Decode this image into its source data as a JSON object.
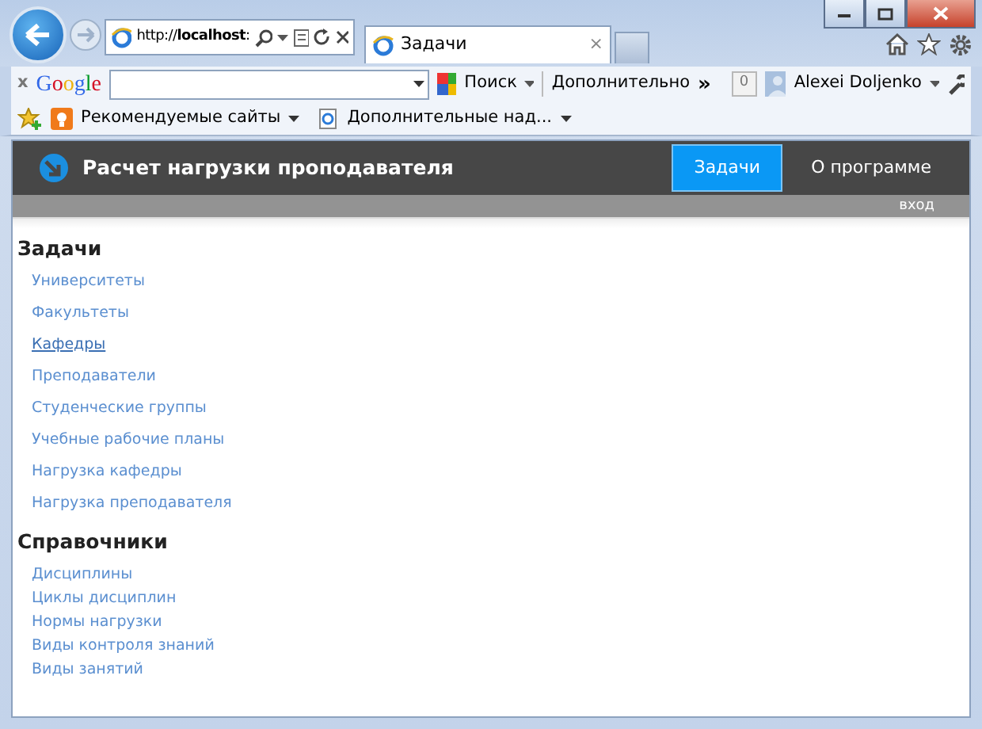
{
  "browser": {
    "address": "http://**localhost**:",
    "tab": {
      "title": "Задачи",
      "close": "×"
    },
    "toolbar": {
      "close": "x",
      "logo": "Google",
      "search_label": "Поиск",
      "more": "Дополнительно",
      "more_glyph": "»",
      "counter": "0",
      "user": "Alexei Doljenko"
    },
    "favorites": [
      {
        "label": "Рекомендуемые сайты",
        "kind": "suggested"
      },
      {
        "label": "Дополнительные над...",
        "kind": "addons"
      }
    ]
  },
  "app": {
    "title": "Расчет нагрузки проподавателя",
    "nav": [
      {
        "label": "Задачи",
        "selected": true
      },
      {
        "label": "О программе",
        "selected": false
      }
    ],
    "login": "вход"
  },
  "sections": [
    {
      "heading": "Задачи",
      "items": [
        {
          "label": "Университеты",
          "hovered": false
        },
        {
          "label": "Факультеты",
          "hovered": false
        },
        {
          "label": "Кафедры",
          "hovered": true
        },
        {
          "label": "Преподаватели",
          "hovered": false
        },
        {
          "label": "Студенческие группы",
          "hovered": false
        },
        {
          "label": "Учебные рабочие планы",
          "hovered": false
        },
        {
          "label": "Нагрузка кафедры",
          "hovered": false
        },
        {
          "label": "Нагрузка преподавателя",
          "hovered": false
        }
      ]
    },
    {
      "heading": "Справочники",
      "items": [
        {
          "label": "Дисциплины",
          "hovered": false
        },
        {
          "label": "Циклы дисциплин",
          "hovered": false
        },
        {
          "label": "Нормы нагрузки",
          "hovered": false
        },
        {
          "label": "Виды контроля знаний",
          "hovered": false
        },
        {
          "label": "Виды занятий",
          "hovered": false
        }
      ]
    }
  ]
}
